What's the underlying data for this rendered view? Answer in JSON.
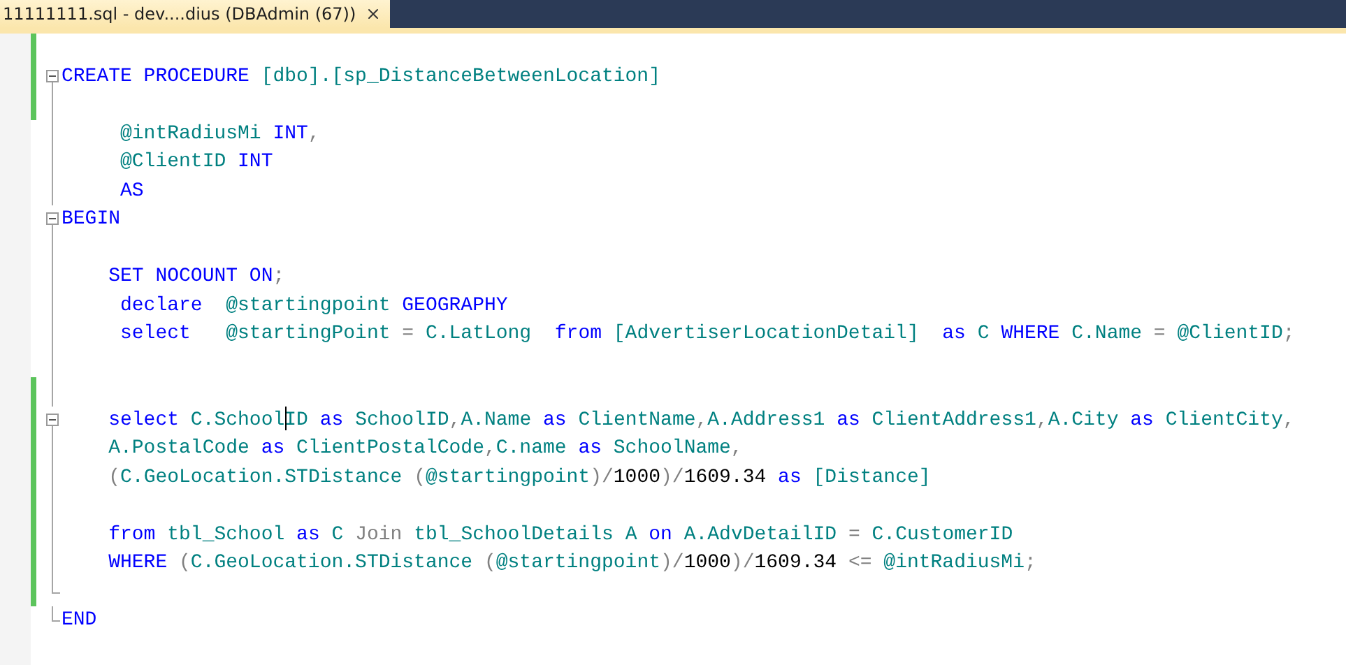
{
  "tab": {
    "title": "11111111.sql - dev....dius (DBAdmin (67))"
  },
  "lines": [
    {
      "changed": true,
      "fold_box": false,
      "fold_guide": false,
      "fold_end": false
    },
    {
      "changed": true,
      "fold_box": true,
      "fold_guide": false,
      "fold_end": false,
      "tokens": [
        {
          "kind": "keyword",
          "text": "CREATE PROCEDURE "
        },
        {
          "kind": "ident",
          "text": "[dbo].[sp_DistanceBetweenLocation]"
        }
      ]
    },
    {
      "changed": true,
      "fold_box": false,
      "fold_guide": true,
      "fold_end": false
    },
    {
      "changed": false,
      "fold_box": false,
      "fold_guide": true,
      "fold_end": false,
      "tokens": [
        {
          "kind": "ident",
          "text": "     @intRadiusMi "
        },
        {
          "kind": "keyword",
          "text": "INT"
        },
        {
          "kind": "operator",
          "text": ","
        }
      ]
    },
    {
      "changed": false,
      "fold_box": false,
      "fold_guide": true,
      "fold_end": false,
      "tokens": [
        {
          "kind": "ident",
          "text": "     @ClientID "
        },
        {
          "kind": "keyword",
          "text": "INT"
        }
      ]
    },
    {
      "changed": false,
      "fold_box": false,
      "fold_guide": true,
      "fold_end": false,
      "tokens": [
        {
          "kind": "keyword",
          "text": "     AS"
        }
      ]
    },
    {
      "changed": false,
      "fold_box": true,
      "fold_guide": false,
      "fold_end": false,
      "tokens": [
        {
          "kind": "keyword",
          "text": "BEGIN"
        }
      ]
    },
    {
      "changed": false,
      "fold_box": false,
      "fold_guide": true,
      "fold_end": false
    },
    {
      "changed": false,
      "fold_box": false,
      "fold_guide": true,
      "fold_end": false,
      "tokens": [
        {
          "kind": "keyword",
          "text": "    SET NOCOUNT ON"
        },
        {
          "kind": "operator",
          "text": ";"
        }
      ]
    },
    {
      "changed": false,
      "fold_box": false,
      "fold_guide": true,
      "fold_end": false,
      "tokens": [
        {
          "kind": "keyword",
          "text": "     declare  "
        },
        {
          "kind": "ident",
          "text": "@startingpoint "
        },
        {
          "kind": "keyword",
          "text": "GEOGRAPHY"
        }
      ]
    },
    {
      "changed": false,
      "fold_box": false,
      "fold_guide": true,
      "fold_end": false,
      "tokens": [
        {
          "kind": "keyword",
          "text": "     select   "
        },
        {
          "kind": "ident",
          "text": "@startingPoint "
        },
        {
          "kind": "operator",
          "text": "= "
        },
        {
          "kind": "ident",
          "text": "C.LatLong  "
        },
        {
          "kind": "keyword",
          "text": "from "
        },
        {
          "kind": "ident",
          "text": "[AdvertiserLocationDetail]  "
        },
        {
          "kind": "keyword",
          "text": "as "
        },
        {
          "kind": "ident",
          "text": "C "
        },
        {
          "kind": "keyword",
          "text": "WHERE "
        },
        {
          "kind": "ident",
          "text": "C.Name "
        },
        {
          "kind": "operator",
          "text": "= "
        },
        {
          "kind": "ident",
          "text": "@ClientID"
        },
        {
          "kind": "operator",
          "text": ";"
        }
      ]
    },
    {
      "changed": false,
      "fold_box": false,
      "fold_guide": true,
      "fold_end": false
    },
    {
      "changed": true,
      "fold_box": false,
      "fold_guide": true,
      "fold_end": false
    },
    {
      "changed": true,
      "fold_box": true,
      "fold_guide": false,
      "fold_end": false,
      "tokens": [
        {
          "kind": "keyword",
          "text": "    select "
        },
        {
          "kind": "ident",
          "text": "C.School"
        },
        {
          "kind": "caret"
        },
        {
          "kind": "ident",
          "text": "ID "
        },
        {
          "kind": "keyword",
          "text": "as "
        },
        {
          "kind": "ident",
          "text": "SchoolID"
        },
        {
          "kind": "operator",
          "text": ","
        },
        {
          "kind": "ident",
          "text": "A.Name "
        },
        {
          "kind": "keyword",
          "text": "as "
        },
        {
          "kind": "ident",
          "text": "ClientName"
        },
        {
          "kind": "operator",
          "text": ","
        },
        {
          "kind": "ident",
          "text": "A.Address1 "
        },
        {
          "kind": "keyword",
          "text": "as "
        },
        {
          "kind": "ident",
          "text": "ClientAddress1"
        },
        {
          "kind": "operator",
          "text": ","
        },
        {
          "kind": "ident",
          "text": "A.City "
        },
        {
          "kind": "keyword",
          "text": "as "
        },
        {
          "kind": "ident",
          "text": "ClientCity"
        },
        {
          "kind": "operator",
          "text": ","
        }
      ]
    },
    {
      "changed": true,
      "fold_box": false,
      "fold_guide": true,
      "fold_end": false,
      "tokens": [
        {
          "kind": "ident",
          "text": "    A.PostalCode "
        },
        {
          "kind": "keyword",
          "text": "as "
        },
        {
          "kind": "ident",
          "text": "ClientPostalCode"
        },
        {
          "kind": "operator",
          "text": ","
        },
        {
          "kind": "ident",
          "text": "C.name "
        },
        {
          "kind": "keyword",
          "text": "as "
        },
        {
          "kind": "ident",
          "text": "SchoolName"
        },
        {
          "kind": "operator",
          "text": ","
        }
      ]
    },
    {
      "changed": true,
      "fold_box": false,
      "fold_guide": true,
      "fold_end": false,
      "tokens": [
        {
          "kind": "operator",
          "text": "    ("
        },
        {
          "kind": "ident",
          "text": "C.GeoLocation.STDistance "
        },
        {
          "kind": "operator",
          "text": "("
        },
        {
          "kind": "ident",
          "text": "@startingpoint"
        },
        {
          "kind": "operator",
          "text": ")/"
        },
        {
          "kind": "number",
          "text": "1000"
        },
        {
          "kind": "operator",
          "text": ")/"
        },
        {
          "kind": "number",
          "text": "1609.34 "
        },
        {
          "kind": "keyword",
          "text": "as "
        },
        {
          "kind": "ident",
          "text": "[Distance]"
        }
      ]
    },
    {
      "changed": true,
      "fold_box": false,
      "fold_guide": true,
      "fold_end": false
    },
    {
      "changed": true,
      "fold_box": false,
      "fold_guide": true,
      "fold_end": false,
      "tokens": [
        {
          "kind": "keyword",
          "text": "    from "
        },
        {
          "kind": "ident",
          "text": "tbl_School "
        },
        {
          "kind": "keyword",
          "text": "as "
        },
        {
          "kind": "ident",
          "text": "C "
        },
        {
          "kind": "operator",
          "text": "Join "
        },
        {
          "kind": "ident",
          "text": "tbl_SchoolDetails A "
        },
        {
          "kind": "keyword",
          "text": "on "
        },
        {
          "kind": "ident",
          "text": "A.AdvDetailID "
        },
        {
          "kind": "operator",
          "text": "= "
        },
        {
          "kind": "ident",
          "text": "C.CustomerID"
        }
      ]
    },
    {
      "changed": true,
      "fold_box": false,
      "fold_guide": true,
      "fold_end": false,
      "tokens": [
        {
          "kind": "keyword",
          "text": "    WHERE "
        },
        {
          "kind": "operator",
          "text": "("
        },
        {
          "kind": "ident",
          "text": "C.GeoLocation.STDistance "
        },
        {
          "kind": "operator",
          "text": "("
        },
        {
          "kind": "ident",
          "text": "@startingpoint"
        },
        {
          "kind": "operator",
          "text": ")/"
        },
        {
          "kind": "number",
          "text": "1000"
        },
        {
          "kind": "operator",
          "text": ")/"
        },
        {
          "kind": "number",
          "text": "1609.34 "
        },
        {
          "kind": "operator",
          "text": "<= "
        },
        {
          "kind": "ident",
          "text": "@intRadiusMi"
        },
        {
          "kind": "operator",
          "text": ";"
        }
      ]
    },
    {
      "changed": true,
      "fold_box": false,
      "fold_guide": false,
      "fold_end": true
    },
    {
      "changed": false,
      "fold_box": false,
      "fold_guide": false,
      "fold_end": true,
      "tokens": [
        {
          "kind": "keyword",
          "text": "END"
        }
      ]
    }
  ]
}
